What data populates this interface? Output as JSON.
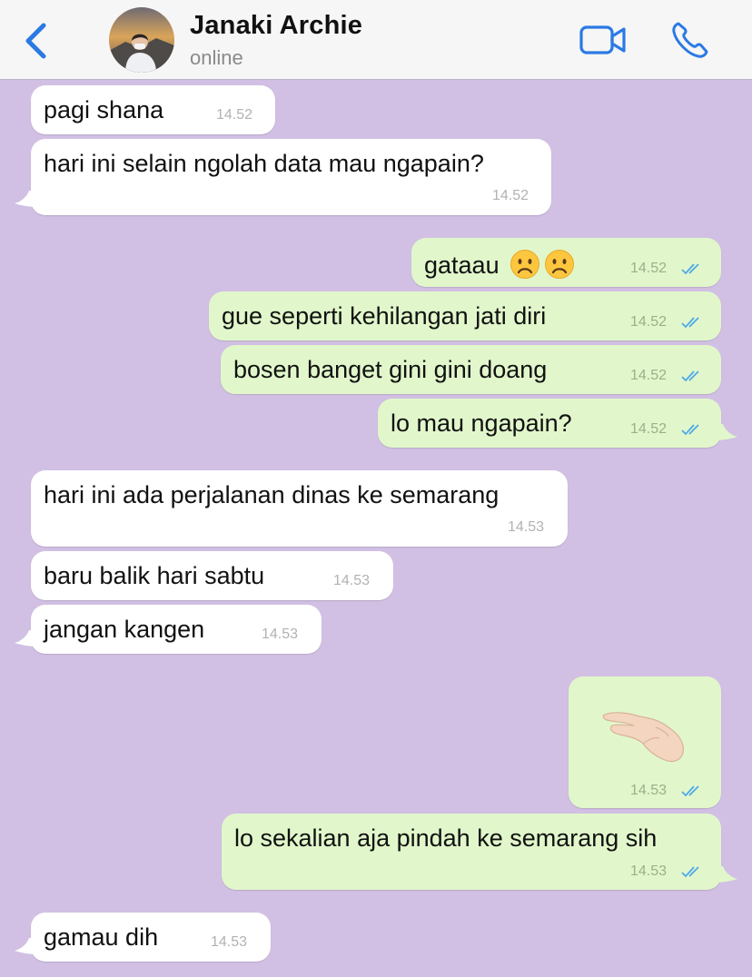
{
  "header": {
    "contact_name": "Janaki Archie",
    "status": "online",
    "back_icon": "chevron-left-icon",
    "video_icon": "video-camera-icon",
    "call_icon": "phone-icon",
    "accent_color": "#2b7ae4"
  },
  "colors": {
    "background": "#d1c0e3",
    "incoming_bubble": "#ffffff",
    "outgoing_bubble": "#e1f7cb",
    "read_tick": "#4fa8e8"
  },
  "messages": [
    {
      "direction": "in",
      "text": "pagi shana",
      "time": "14.52"
    },
    {
      "direction": "in",
      "text": "hari ini selain ngolah data mau ngapain?",
      "time": "14.52"
    },
    {
      "direction": "out",
      "text": "gataau",
      "emoji": [
        "frowning-face-icon",
        "frowning-face-icon"
      ],
      "time": "14.52",
      "read": true
    },
    {
      "direction": "out",
      "text": "gue seperti kehilangan jati diri",
      "time": "14.52",
      "read": true
    },
    {
      "direction": "out",
      "text": "bosen banget gini gini doang",
      "time": "14.52",
      "read": true
    },
    {
      "direction": "out",
      "text": "lo mau ngapain?",
      "time": "14.52",
      "read": true
    },
    {
      "direction": "in",
      "text": "hari ini ada perjalanan dinas ke semarang",
      "time": "14.53"
    },
    {
      "direction": "in",
      "text": "baru balik hari sabtu",
      "time": "14.53"
    },
    {
      "direction": "in",
      "text": "jangan kangen",
      "time": "14.53"
    },
    {
      "direction": "out",
      "sticker": "pinching-hand-icon",
      "time": "14.53",
      "read": true
    },
    {
      "direction": "out",
      "text": "lo sekalian aja pindah ke semarang sih",
      "time": "14.53",
      "read": true
    },
    {
      "direction": "in",
      "text": "gamau dih",
      "time": "14.53"
    }
  ]
}
